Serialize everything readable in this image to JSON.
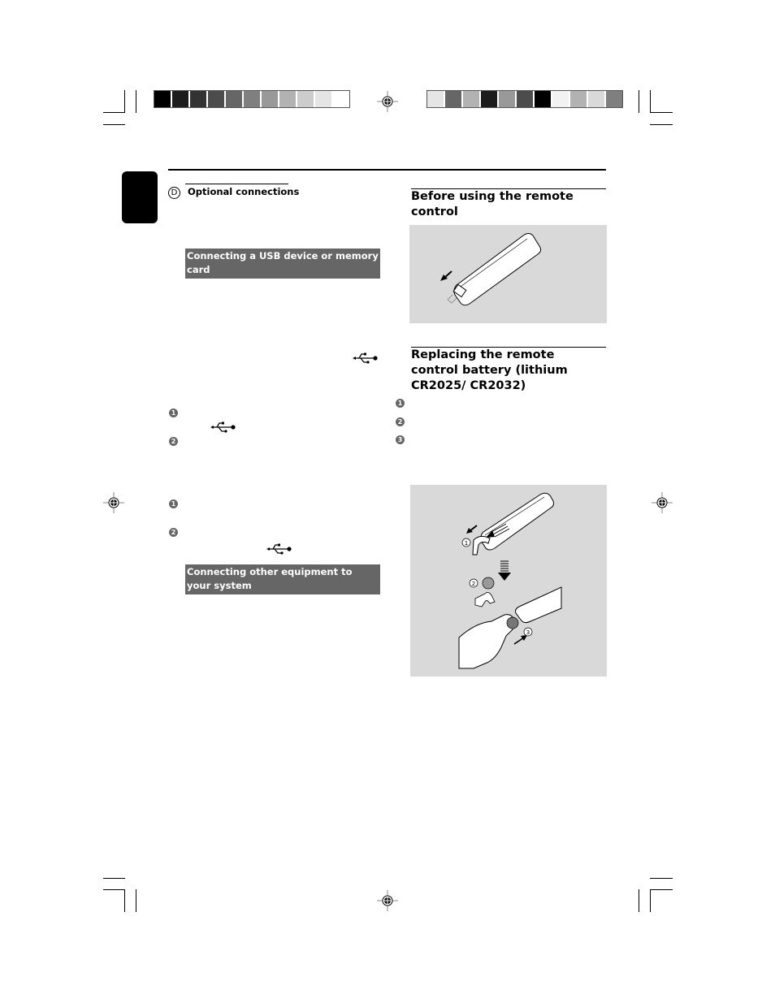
{
  "print_marks": {
    "left_color_bar": [
      "#000000",
      "#1c1c1c",
      "#333333",
      "#4c4c4c",
      "#666666",
      "#7f7f7f",
      "#999999",
      "#b2b2b2",
      "#cccccc",
      "#e5e5e5",
      "#ffffff"
    ],
    "right_color_bar": [
      "#e5e5e5",
      "#666666",
      "#b2b2b2",
      "#1c1c1c",
      "#999999",
      "#4c4c4c",
      "#000000",
      "#f2f2f2",
      "#b2b2b2",
      "#d9d9d9",
      "#7f7f7f"
    ]
  },
  "left_column": {
    "section_marker": "D",
    "section_title": "Optional connections",
    "usb_heading": "Connecting a USB device or memory card",
    "steps_group_1": [
      "1",
      "2"
    ],
    "steps_group_2": [
      "1",
      "2"
    ],
    "other_heading": "Connecting other equipment to your system",
    "icons": [
      "usb-icon",
      "usb-icon",
      "usb-icon"
    ]
  },
  "right_column": {
    "before_heading": "Before using the remote control",
    "replace_heading": "Replacing the remote control battery (lithium CR2025/ CR2032)",
    "replace_steps": [
      "1",
      "2",
      "3"
    ],
    "figure_labels": [
      "1",
      "2",
      "3"
    ]
  }
}
